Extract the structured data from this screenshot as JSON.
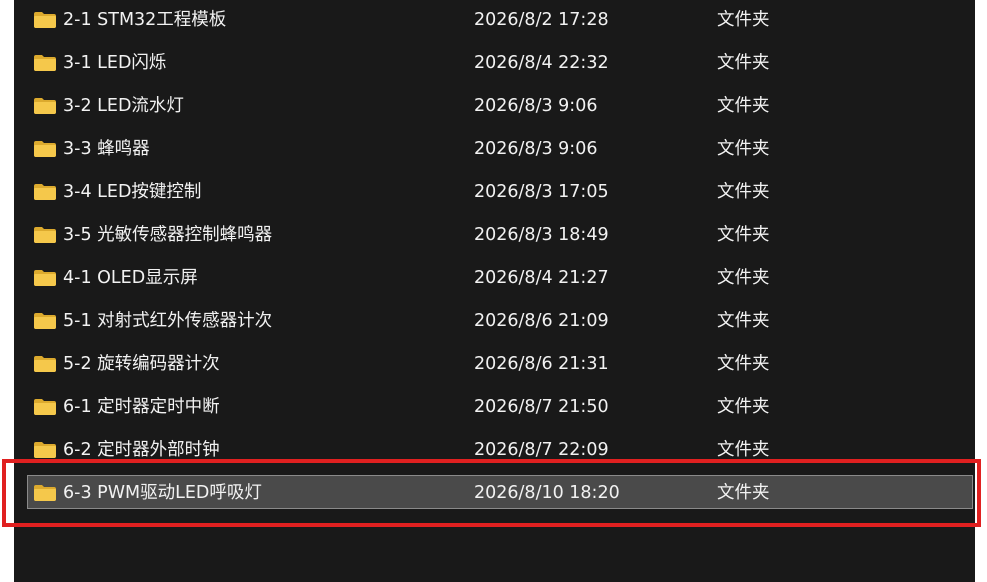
{
  "files": [
    {
      "name": "2-1 STM32工程模板",
      "date": "2026/8/2 17:28",
      "type": "文件夹"
    },
    {
      "name": "3-1 LED闪烁",
      "date": "2026/8/4 22:32",
      "type": "文件夹"
    },
    {
      "name": "3-2 LED流水灯",
      "date": "2026/8/3 9:06",
      "type": "文件夹"
    },
    {
      "name": "3-3 蜂鸣器",
      "date": "2026/8/3 9:06",
      "type": "文件夹"
    },
    {
      "name": "3-4 LED按键控制",
      "date": "2026/8/3 17:05",
      "type": "文件夹"
    },
    {
      "name": "3-5 光敏传感器控制蜂鸣器",
      "date": "2026/8/3 18:49",
      "type": "文件夹"
    },
    {
      "name": "4-1 OLED显示屏",
      "date": "2026/8/4 21:27",
      "type": "文件夹"
    },
    {
      "name": "5-1 对射式红外传感器计次",
      "date": "2026/8/6 21:09",
      "type": "文件夹"
    },
    {
      "name": "5-2 旋转编码器计次",
      "date": "2026/8/6 21:31",
      "type": "文件夹"
    },
    {
      "name": "6-1 定时器定时中断",
      "date": "2026/8/7 21:50",
      "type": "文件夹"
    },
    {
      "name": "6-2 定时器外部时钟",
      "date": "2026/8/7 22:09",
      "type": "文件夹"
    },
    {
      "name": "6-3 PWM驱动LED呼吸灯",
      "date": "2026/8/10 18:20",
      "type": "文件夹",
      "selected": true
    }
  ],
  "colors": {
    "background": "#191919",
    "text": "#f2f2f2",
    "selected_row": "#4a4a4a",
    "highlight_box": "#e02020",
    "folder": "#f0c04a"
  },
  "icons": {
    "folder": "folder-icon"
  }
}
